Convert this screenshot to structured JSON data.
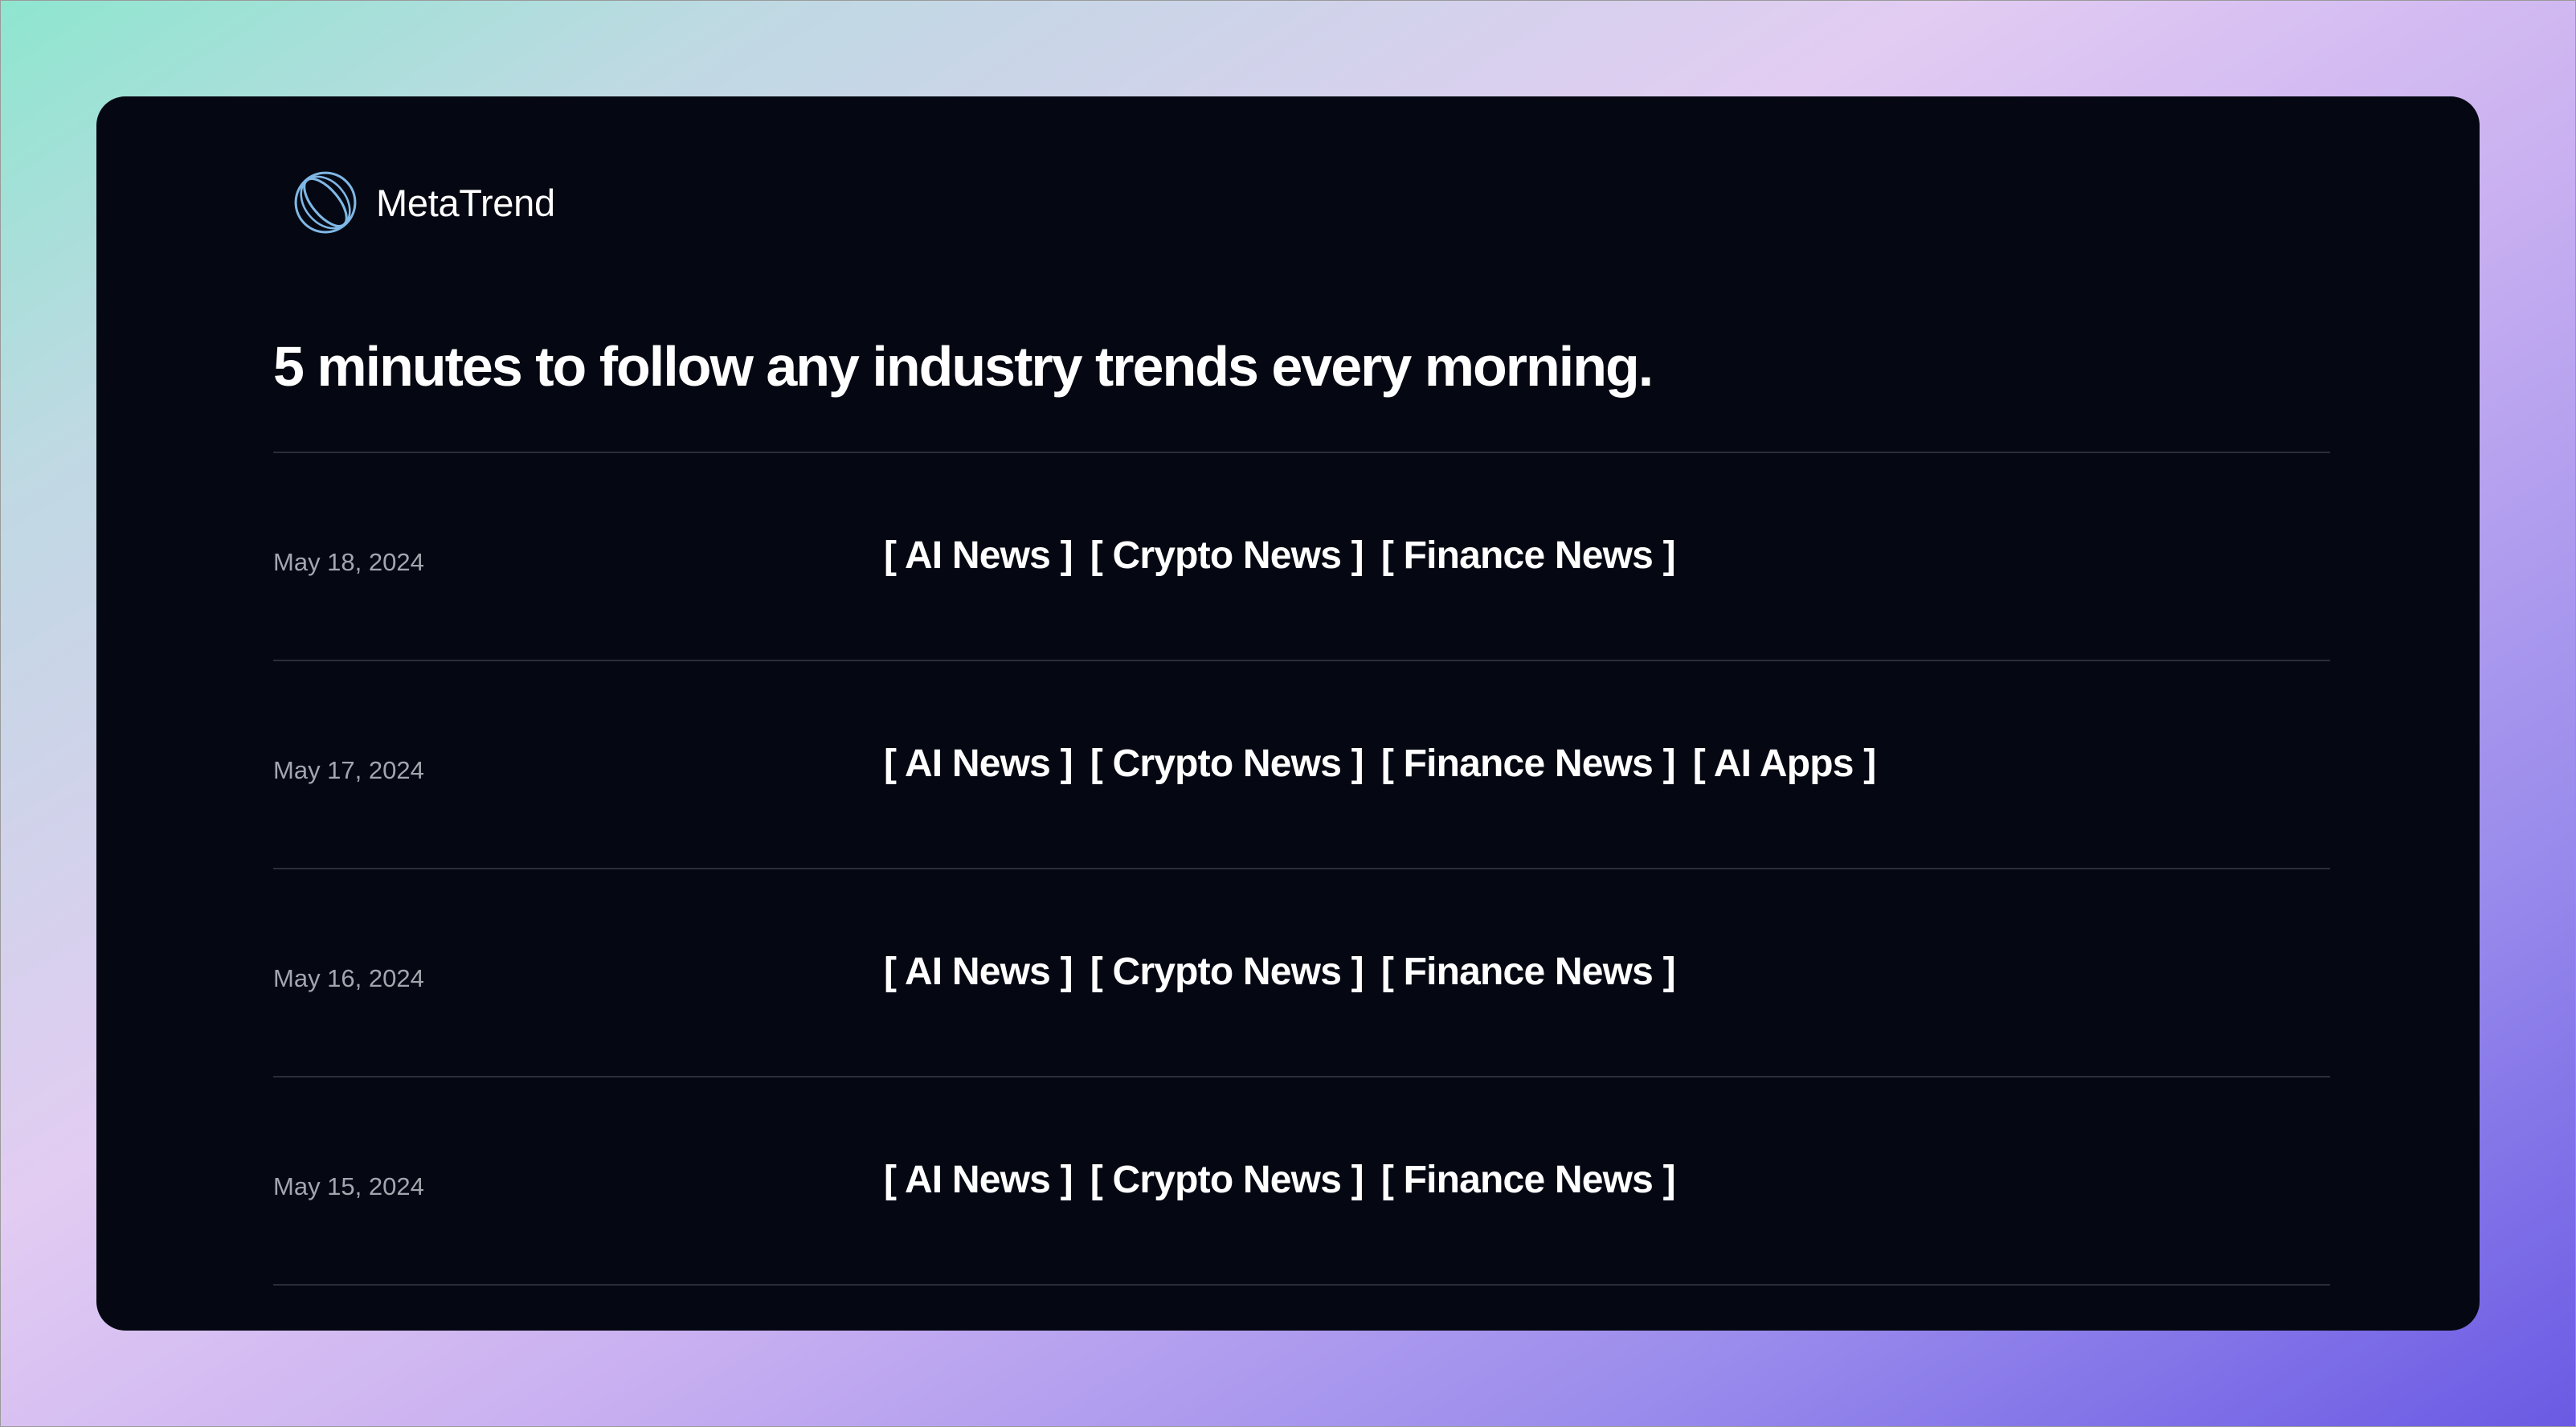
{
  "brand": {
    "name": "MetaTrend",
    "logo_icon": "ring-orbit-icon",
    "logo_color": "#7fb8e6"
  },
  "headline": "5 minutes to follow any industry trends every morning.",
  "entries": [
    {
      "date": "May 18, 2024",
      "tags": [
        "[ AI News ]",
        "[ Crypto News ]",
        "[ Finance News ]"
      ]
    },
    {
      "date": "May 17, 2024",
      "tags": [
        "[ AI News ]",
        "[ Crypto News ]",
        "[ Finance News ]",
        "[ AI Apps ]"
      ]
    },
    {
      "date": "May 16, 2024",
      "tags": [
        "[ AI News ]",
        "[ Crypto News ]",
        "[ Finance News ]"
      ]
    },
    {
      "date": "May 15, 2024",
      "tags": [
        "[ AI News ]",
        "[ Crypto News ]",
        "[ Finance News ]"
      ]
    }
  ],
  "colors": {
    "card_background": "#050812",
    "divider": "#2a2e38",
    "date_text": "#a3a6ae",
    "text": "#ffffff"
  }
}
